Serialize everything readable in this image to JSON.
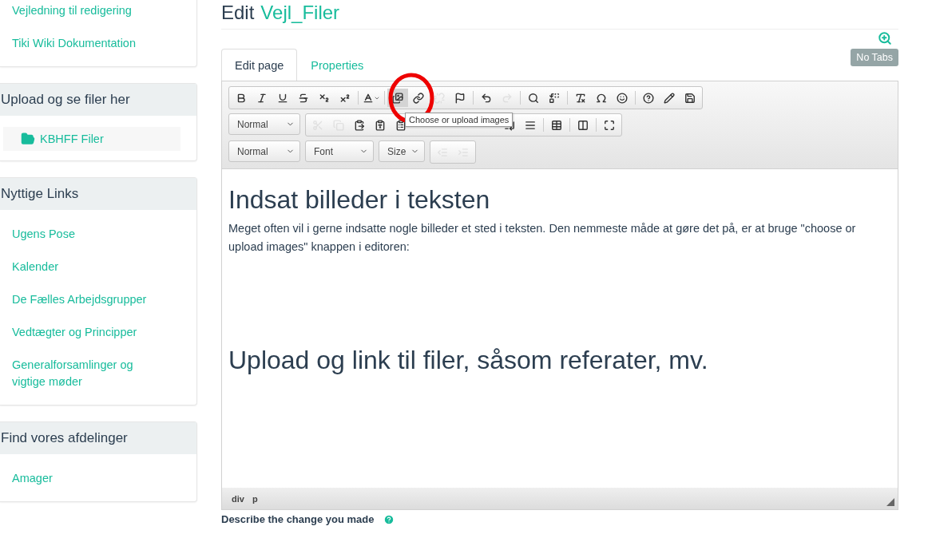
{
  "sidebar": [
    {
      "items": [
        {
          "label": "Vejledning til redigering"
        },
        {
          "label": "Tiki Wiki Dokumentation"
        }
      ]
    },
    {
      "heading": "Upload og se filer her",
      "folder": {
        "label": "KBHFF Filer"
      }
    },
    {
      "heading": "Nyttige Links",
      "items": [
        {
          "label": "Ugens Pose"
        },
        {
          "label": "Kalender"
        },
        {
          "label": "De Fælles Arbejdsgrupper"
        },
        {
          "label": "Vedtægter og Principper"
        },
        {
          "label": "Generalforsamlinger og vigtige møder"
        }
      ]
    },
    {
      "heading": "Find vores afdelinger",
      "items": [
        {
          "label": "Amager"
        }
      ]
    }
  ],
  "title": {
    "prefix": "Edit",
    "page": "Vejl_Filer"
  },
  "no_tabs_button": "No Tabs",
  "tabs": [
    {
      "label": "Edit page",
      "selected": true
    },
    {
      "label": "Properties",
      "selected": false
    }
  ],
  "toolbar_rows": [
    [
      {
        "kind": "group",
        "items": [
          {
            "disabled": false
          },
          {
            "disabled": false
          },
          {
            "disabled": false
          },
          {
            "disabled": false
          },
          {
            "disabled": false
          },
          {
            "disabled": false
          },
          {
            "kind": "sep"
          },
          {
            "disabled": false,
            "caret": true
          },
          {
            "kind": "sep"
          },
          {
            "disabled": false,
            "highlighted": true
          },
          {
            "disabled": false
          },
          {
            "disabled": true
          },
          {
            "disabled": false
          },
          {
            "kind": "sep"
          },
          {
            "disabled": false
          },
          {
            "disabled": true
          },
          {
            "kind": "sep"
          },
          {
            "disabled": false
          },
          {
            "disabled": false
          },
          {
            "kind": "sep"
          },
          {
            "disabled": false
          },
          {
            "disabled": false
          },
          {
            "disabled": false
          },
          {
            "kind": "sep"
          },
          {
            "disabled": false
          },
          {
            "disabled": false
          },
          {
            "disabled": false
          }
        ]
      }
    ],
    [
      {
        "kind": "dropdown",
        "label": "Normal"
      },
      {
        "kind": "group",
        "items": [
          {
            "disabled": true
          },
          {
            "disabled": true
          },
          {
            "disabled": false
          },
          {
            "disabled": false
          },
          {
            "disabled": false
          },
          {
            "kind": "gap"
          },
          {
            "disabled": false
          },
          {
            "disabled": false
          },
          {
            "kind": "sep"
          },
          {
            "disabled": false
          },
          {
            "kind": "sep"
          },
          {
            "disabled": false
          },
          {
            "kind": "sep"
          },
          {
            "disabled": false
          }
        ]
      }
    ],
    [
      {
        "kind": "dropdown",
        "label": "Normal"
      },
      {
        "kind": "dropdown",
        "label": "Font"
      },
      {
        "kind": "dropdown",
        "label": "Size"
      },
      {
        "kind": "group",
        "items": [
          {
            "disabled": true
          },
          {
            "disabled": true
          }
        ]
      }
    ]
  ],
  "tooltip": "Choose or upload images",
  "content": [
    {
      "kind": "heading",
      "text": "Indsat billeder i teksten"
    },
    {
      "kind": "paragraph",
      "text": "Meget often vil i gerne indsatte nogle billeder et sted i teksten. Den nemmeste måde at gøre det på, er at bruge \"choose or upload images\" knappen i editoren:"
    },
    {
      "kind": "spacer"
    },
    {
      "kind": "heading",
      "text": "Upload og link til filer, såsom referater, mv."
    }
  ],
  "path": [
    "div",
    "p"
  ],
  "describe_label": "Describe the change you made"
}
